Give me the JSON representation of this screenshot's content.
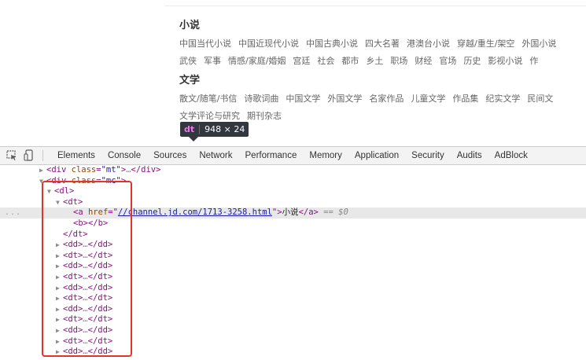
{
  "preview": {
    "sections": [
      {
        "title": "小说",
        "rows": [
          [
            "中国当代小说",
            "中国近现代小说",
            "中国古典小说",
            "四大名著",
            "港澳台小说",
            "穿越/重生/架空",
            "外国小说"
          ],
          [
            "武侠",
            "军事",
            "情感/家庭/婚姻",
            "宫廷",
            "社会",
            "都市",
            "乡土",
            "职场",
            "财经",
            "官场",
            "历史",
            "影视小说",
            "作"
          ]
        ]
      },
      {
        "title": "文学",
        "rows": [
          [
            "散文/随笔/书信",
            "诗歌词曲",
            "中国文学",
            "外国文学",
            "名家作品",
            "儿童文学",
            "作品集",
            "纪实文学",
            "民间文"
          ],
          [
            "文学评论与研究",
            "期刊杂志"
          ]
        ]
      }
    ],
    "tooltip": {
      "tag": "dt",
      "size": "948 × 24"
    }
  },
  "toolbar": {
    "tabs": [
      "Elements",
      "Console",
      "Sources",
      "Network",
      "Performance",
      "Memory",
      "Application",
      "Security",
      "Audits",
      "AdBlock"
    ],
    "icons": [
      "inspect-element-icon",
      "device-toolbar-icon"
    ]
  },
  "elements": {
    "gutter": "...",
    "l1": {
      "arrow": "▶",
      "open": "<div",
      "attr": "class",
      "eq": "=",
      "val": "\"mt\"",
      "close": ">",
      "dots": "…",
      "end": "</div>"
    },
    "l2": {
      "arrow": "▼",
      "open": "<div",
      "attr": "class",
      "eq": "=",
      "val": "\"mc\"",
      "close": ">"
    },
    "l3": {
      "arrow": "▼",
      "tag": "<dl>"
    },
    "l4": {
      "arrow": "▼",
      "tag": "<dt>"
    },
    "l5": {
      "open": "<a",
      "attr": "href",
      "eq": "=\"",
      "link": "//channel.jd.com/1713-3258.html",
      "q": "\">",
      "text": "小说",
      "end": "</a>",
      "eqeq": " == ",
      "dollar": "$0"
    },
    "l6": {
      "tag": "<b></b>"
    },
    "l7": {
      "tag": "</dt>"
    },
    "collapsed": [
      {
        "arrow": "▶",
        "open": "<dd>",
        "dots": "…",
        "end": "</dd>"
      },
      {
        "arrow": "▶",
        "open": "<dt>",
        "dots": "…",
        "end": "</dt>"
      },
      {
        "arrow": "▶",
        "open": "<dd>",
        "dots": "…",
        "end": "</dd>"
      },
      {
        "arrow": "▶",
        "open": "<dt>",
        "dots": "…",
        "end": "</dt>"
      },
      {
        "arrow": "▶",
        "open": "<dd>",
        "dots": "…",
        "end": "</dd>"
      },
      {
        "arrow": "▶",
        "open": "<dt>",
        "dots": "…",
        "end": "</dt>"
      },
      {
        "arrow": "▶",
        "open": "<dd>",
        "dots": "…",
        "end": "</dd>"
      },
      {
        "arrow": "▶",
        "open": "<dt>",
        "dots": "…",
        "end": "</dt>"
      },
      {
        "arrow": "▶",
        "open": "<dd>",
        "dots": "…",
        "end": "</dd>"
      },
      {
        "arrow": "▶",
        "open": "<dt>",
        "dots": "…",
        "end": "</dt>"
      },
      {
        "arrow": "▶",
        "open": "<dd>",
        "dots": "…",
        "end": "</dd>"
      }
    ]
  },
  "colors": {
    "highlight_box": "#e0352b",
    "tag": "#881280",
    "attr_name": "#994500",
    "attr_value": "#1a1aa6"
  }
}
